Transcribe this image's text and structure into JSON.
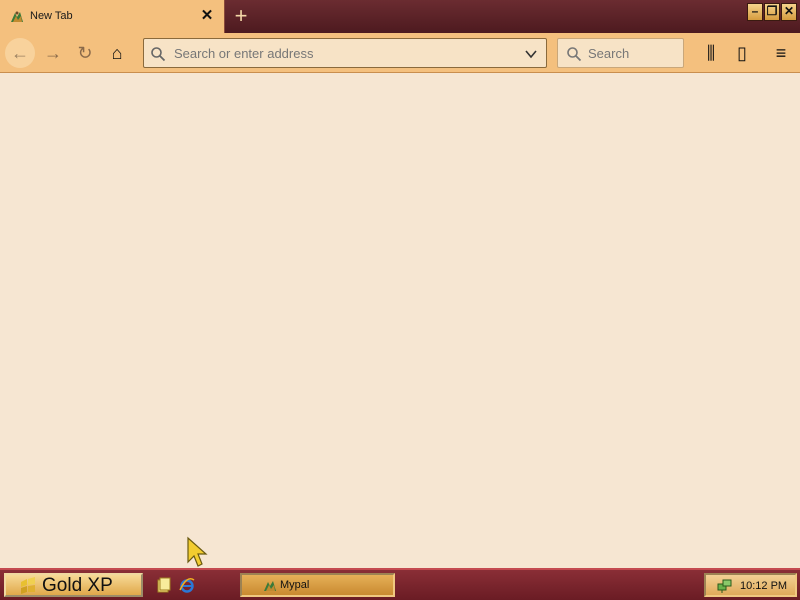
{
  "browser": {
    "tab": {
      "title": "New Tab",
      "favicon": "mypal-logo-icon",
      "close_symbol": "✕"
    },
    "new_tab_symbol": "+",
    "window_controls": {
      "minimize": "–",
      "maximize": "❐",
      "close": "✕"
    }
  },
  "toolbar": {
    "back_icon": "←",
    "forward_icon": "→",
    "reload_icon": "↻",
    "home_icon": "⌂",
    "url": {
      "value": "",
      "placeholder": "Search or enter address"
    },
    "search": {
      "placeholder": "Search"
    },
    "library_icon": "⫼",
    "sidebar_icon": "▯",
    "menu_icon": "≡"
  },
  "taskbar": {
    "start_label": "Gold XP",
    "quick_launch": [
      "folder-icon",
      "internet-explorer-icon"
    ],
    "tasks": [
      {
        "label": "Mypal",
        "icon": "mypal-logo-icon"
      }
    ],
    "clock": "10:12 PM"
  },
  "colors": {
    "title_bar": "#5c2228",
    "tab_active": "#f4c07e",
    "toolbar": "#f4c07e",
    "content_bg": "#f6e6d2",
    "taskbar": "#7a242c",
    "start_button": "#e8b860"
  }
}
